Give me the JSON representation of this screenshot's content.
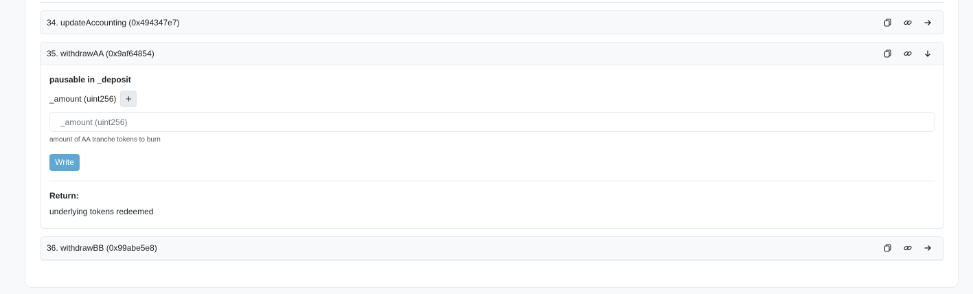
{
  "functions": [
    {
      "title": "34. updateAccounting (0x494347e7)",
      "expand_icon": "arrow-right-icon"
    },
    {
      "title": "35. withdrawAA (0x9af64854)",
      "expand_icon": "arrow-down-icon",
      "modifier": "pausable in _deposit",
      "param_label": "_amount (uint256)",
      "plus_label": "+",
      "input_placeholder": "_amount (uint256)",
      "input_value": "",
      "hint": "amount of AA tranche tokens to burn",
      "write_label": "Write",
      "return_title": "Return:",
      "return_text": "underlying tokens redeemed"
    },
    {
      "title": "36. withdrawBB (0x99abe5e8)",
      "expand_icon": "arrow-right-icon"
    }
  ],
  "colors": {
    "write_button": "#5fa8d3",
    "border": "#e7eaf3",
    "header_bg": "#f8f9fa"
  }
}
